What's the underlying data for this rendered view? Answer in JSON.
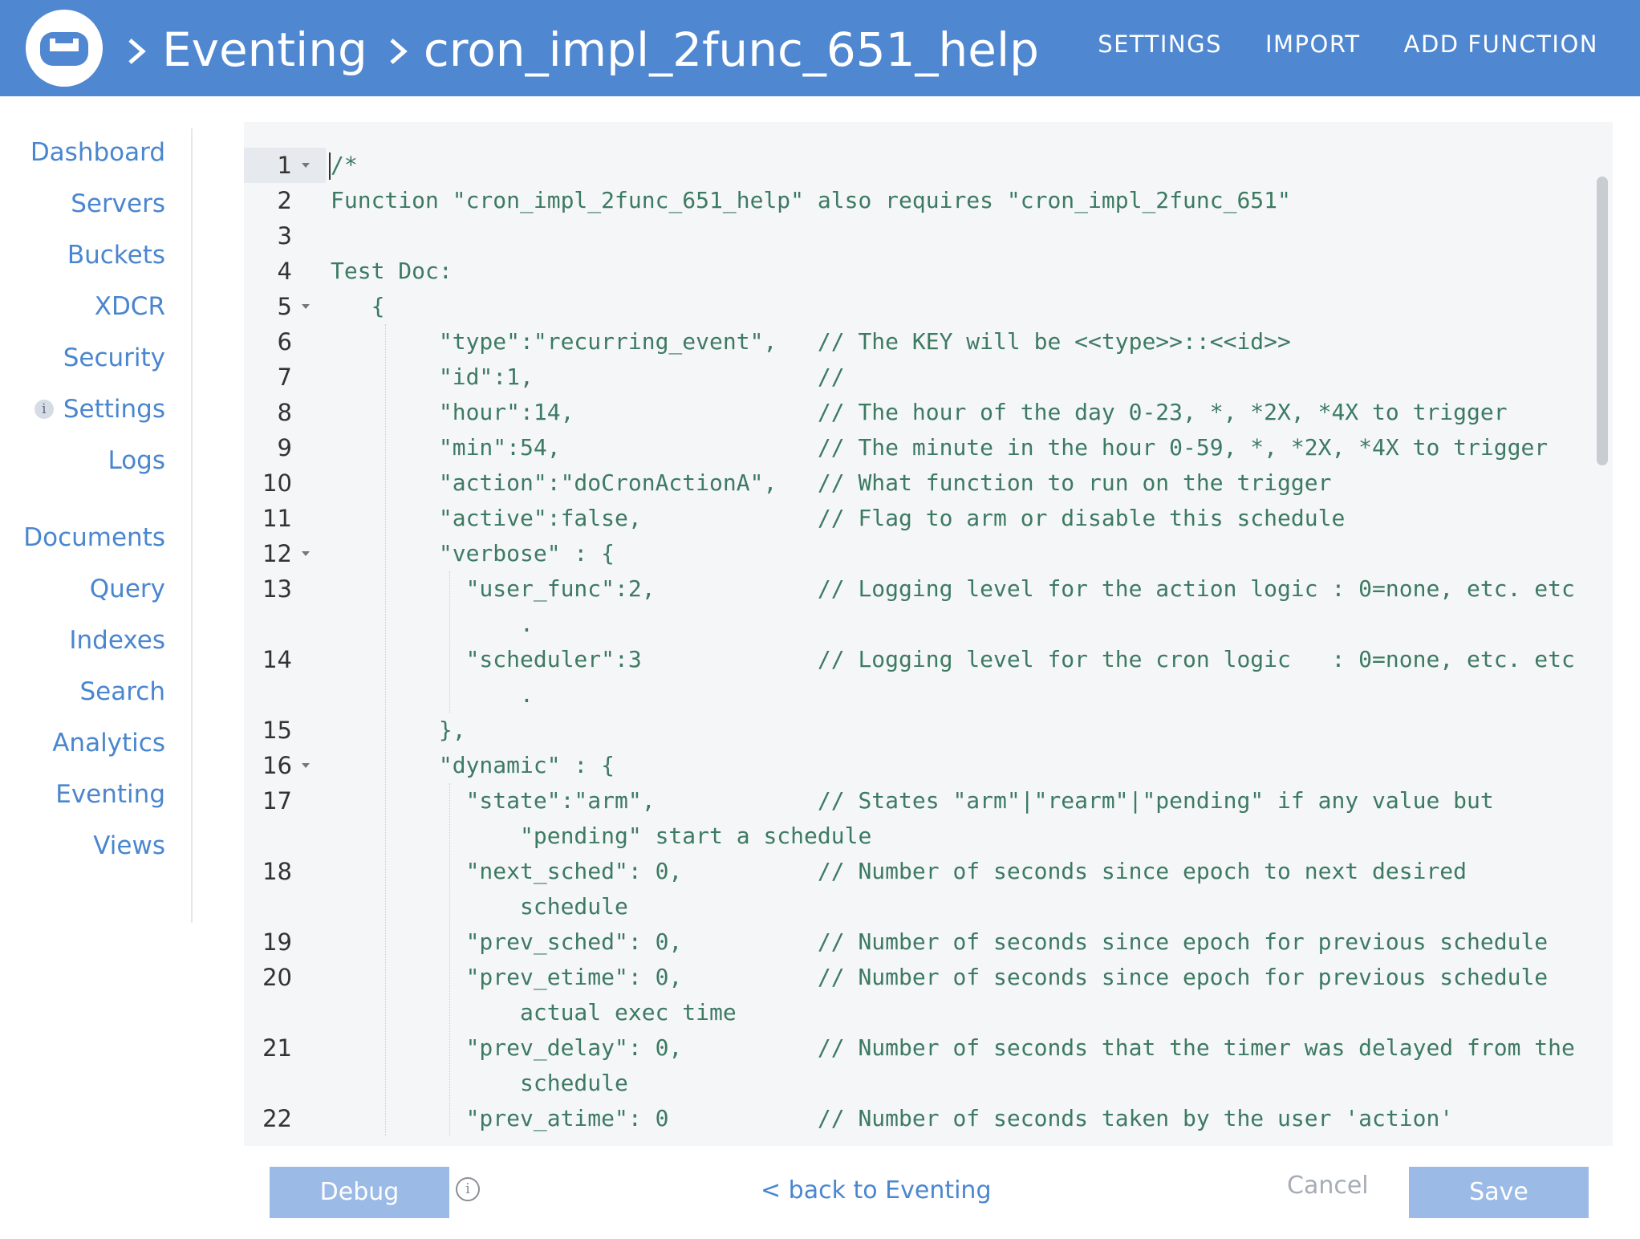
{
  "header": {
    "breadcrumbs": [
      "Eventing",
      "cron_impl_2func_651_help"
    ],
    "nav": [
      "SETTINGS",
      "IMPORT",
      "ADD FUNCTION"
    ]
  },
  "sidebar": {
    "items": [
      "Dashboard",
      "Servers",
      "Buckets",
      "XDCR",
      "Security",
      "Settings",
      "Logs",
      "Documents",
      "Query",
      "Indexes",
      "Search",
      "Analytics",
      "Eventing",
      "Views"
    ],
    "settings_badge": "i"
  },
  "editor": {
    "line_numbers": [
      "1",
      "2",
      "3",
      "4",
      "5",
      "6",
      "7",
      "8",
      "9",
      "10",
      "11",
      "12",
      "13",
      "",
      "14",
      "",
      "15",
      "16",
      "17",
      "",
      "18",
      "",
      "19",
      "20",
      "",
      "21",
      "",
      "22"
    ],
    "lines": [
      "/*",
      "Function \"cron_impl_2func_651_help\" also requires \"cron_impl_2func_651\"",
      "",
      "Test Doc:",
      "   {",
      "        \"type\":\"recurring_event\",   // The KEY will be <<type>>::<<id>>",
      "        \"id\":1,                     //",
      "        \"hour\":14,                  // The hour of the day 0-23, *, *2X, *4X to trigger",
      "        \"min\":54,                   // The minute in the hour 0-59, *, *2X, *4X to trigger",
      "        \"action\":\"doCronActionA\",   // What function to run on the trigger",
      "        \"active\":false,             // Flag to arm or disable this schedule",
      "        \"verbose\" : {",
      "          \"user_func\":2,            // Logging level for the action logic : 0=none, etc. etc",
      "              .",
      "          \"scheduler\":3             // Logging level for the cron logic   : 0=none, etc. etc",
      "              .",
      "        },",
      "        \"dynamic\" : {",
      "          \"state\":\"arm\",            // States \"arm\"|\"rearm\"|\"pending\" if any value but",
      "              \"pending\" start a schedule",
      "          \"next_sched\": 0,          // Number of seconds since epoch to next desired",
      "              schedule",
      "          \"prev_sched\": 0,          // Number of seconds since epoch for previous schedule",
      "          \"prev_etime\": 0,          // Number of seconds since epoch for previous schedule",
      "              actual exec time",
      "          \"prev_delay\": 0,          // Number of seconds that the timer was delayed from the",
      "              schedule",
      "          \"prev_atime\": 0           // Number of seconds taken by the user 'action'"
    ]
  },
  "footer": {
    "debug_label": "Debug",
    "info_glyph": "i",
    "back_link": "< back to Eventing",
    "cancel_label": "Cancel",
    "save_label": "Save"
  },
  "colors": {
    "header_bg": "#4f87d1",
    "link": "#4a86cf",
    "code_text": "#3d7a62",
    "button_bg": "#9bbae6"
  },
  "icons": [
    "couchbase-logo-icon",
    "chevron-right-icon",
    "info-icon",
    "fold-arrow-icon"
  ]
}
